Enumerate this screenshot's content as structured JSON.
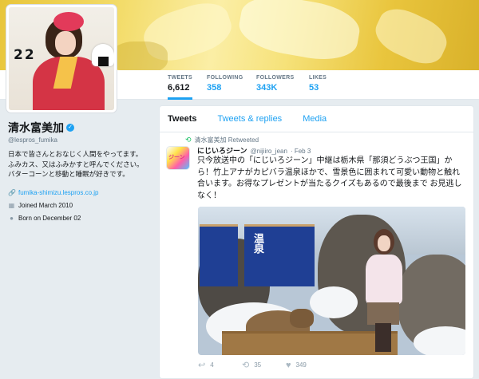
{
  "profile": {
    "display_name": "清水富美加",
    "handle": "@lespros_fumika",
    "bio": "日本で皆さんとおなじく人間をやってます。 ふみカス、又はふみかすと呼んでください。 バターコーンと移動と睡眠が好きです。",
    "website": "fumika-shimizu.lespros.co.jp",
    "joined": "Joined March 2010",
    "born": "Born on December 02",
    "avatar_number": "22"
  },
  "stats": [
    {
      "label": "TWEETS",
      "value": "6,612"
    },
    {
      "label": "FOLLOWING",
      "value": "358"
    },
    {
      "label": "FOLLOWERS",
      "value": "343K"
    },
    {
      "label": "LIKES",
      "value": "53"
    }
  ],
  "tabs": [
    "Tweets",
    "Tweets & replies",
    "Media"
  ],
  "tweet": {
    "retweeted_by": "清水富美加 Retweeted",
    "author": "にじいろジーン",
    "handle": "@nijiiro_jean",
    "date": "· Feb 3",
    "text": "只今放送中の「にじいろジーン」中継は栃木県「那須どうぶつ王国」から！竹上アナがカピバラ温泉ほかで、雪景色に囲まれて可愛い動物と触れ合います。お得なプレゼントが当たるクイズもあるので最後まで お見逃しなく！",
    "photo_sign": "温泉",
    "avatar_text": "ジーン",
    "actions": {
      "reply": "4",
      "retweet": "35",
      "like": "349"
    }
  },
  "icons": {
    "verified": "verified-check-icon",
    "link": "link-icon",
    "calendar": "calendar-icon",
    "balloon": "birthday-balloon-icon",
    "retweet": "retweet-icon",
    "reply": "reply-icon",
    "like": "heart-icon"
  },
  "colors": {
    "accent": "#1da1f2",
    "retweet_green": "#17bf63",
    "text_secondary": "#657786"
  }
}
